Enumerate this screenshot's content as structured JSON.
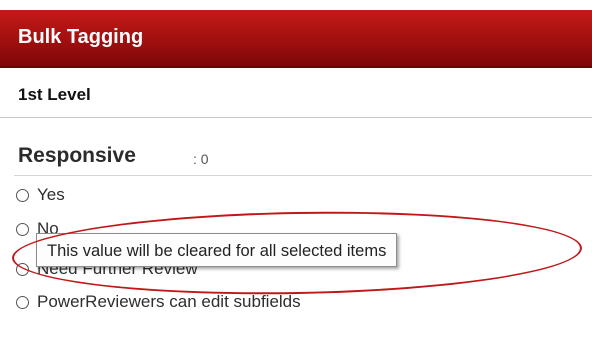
{
  "panel": {
    "title": "Bulk Tagging",
    "level": "1st Level"
  },
  "field": {
    "name": "Responsive",
    "count": ": 0",
    "options": [
      {
        "label": "Yes"
      },
      {
        "label": "No"
      },
      {
        "label": "Need Further Review"
      },
      {
        "label": "PowerReviewers can edit subfields"
      }
    ]
  },
  "tooltip": {
    "text": "This value will be cleared for all selected items"
  },
  "colors": {
    "header_bg": "#a10f0f",
    "annotation": "#c01818"
  }
}
